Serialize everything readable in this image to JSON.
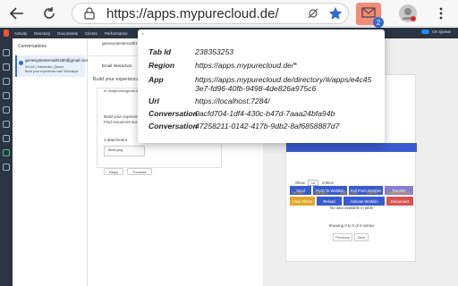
{
  "browser": {
    "url": "https://apps.mypurecloud.de/",
    "extension_badge": "2"
  },
  "app": {
    "nav": [
      "Activity",
      "Directory",
      "Documents",
      "Clients",
      "Performance"
    ],
    "status": "On Queue"
  },
  "conversations": {
    "title": "Conversations",
    "card_email": "genesystestemail0180@gmail.com",
    "card_line2": "00:0x0 | Interaction_Queue",
    "card_line3": "Build your experience with Velvetique"
  },
  "middle": {
    "email_from": "genesystestemail0180",
    "email_interaction": "Email Interaction",
    "body_heading": "Build your experience wit",
    "to_line": "to: ssa@clothingprofit.de",
    "body_text_1": "Build your experience",
    "body_text_2": "Find resources such",
    "attachments_label": "1 attachment",
    "attachment_name": "demo.png",
    "reply_label": "Reply",
    "forward_label": "Forward"
  },
  "right_panel": {
    "show_label": "Show",
    "entries_value": "10",
    "entries_label": "entries",
    "buttons": [
      "Send",
      "Push To Workbin",
      "Pull From Workbin",
      "Transfer",
      "Clear Filters",
      "Reload",
      "Activate Workbin",
      "Disconnect"
    ],
    "columns": [
      "Sender",
      "Subject",
      "Start Time",
      "Owner",
      "Waiting Since"
    ],
    "empty_text": "No data available in table",
    "info_text": "Showing 0 to 0 of 0 entries",
    "prev_label": "Previous",
    "next_label": "Next"
  },
  "popup": {
    "marker": "'",
    "rows": [
      {
        "label": "Tab Id",
        "value": "238353253"
      },
      {
        "label": "Region",
        "value": "https://apps.mypurecloud.de/*"
      },
      {
        "label": "App",
        "value": "https://apps.mypurecloud.de/directory/#/apps/e4c453e7-fd96-40fb-9498-4de826a975c6"
      },
      {
        "label": "Url",
        "value": "https://localhost:7284/"
      },
      {
        "label": "Conversation",
        "value": "0acfd704-1df4-430c-b47d-7aaa24bfa94b"
      },
      {
        "label": "Conversation",
        "value": "47258211-0142-417b-9db2-8af6858887d7"
      }
    ]
  }
}
